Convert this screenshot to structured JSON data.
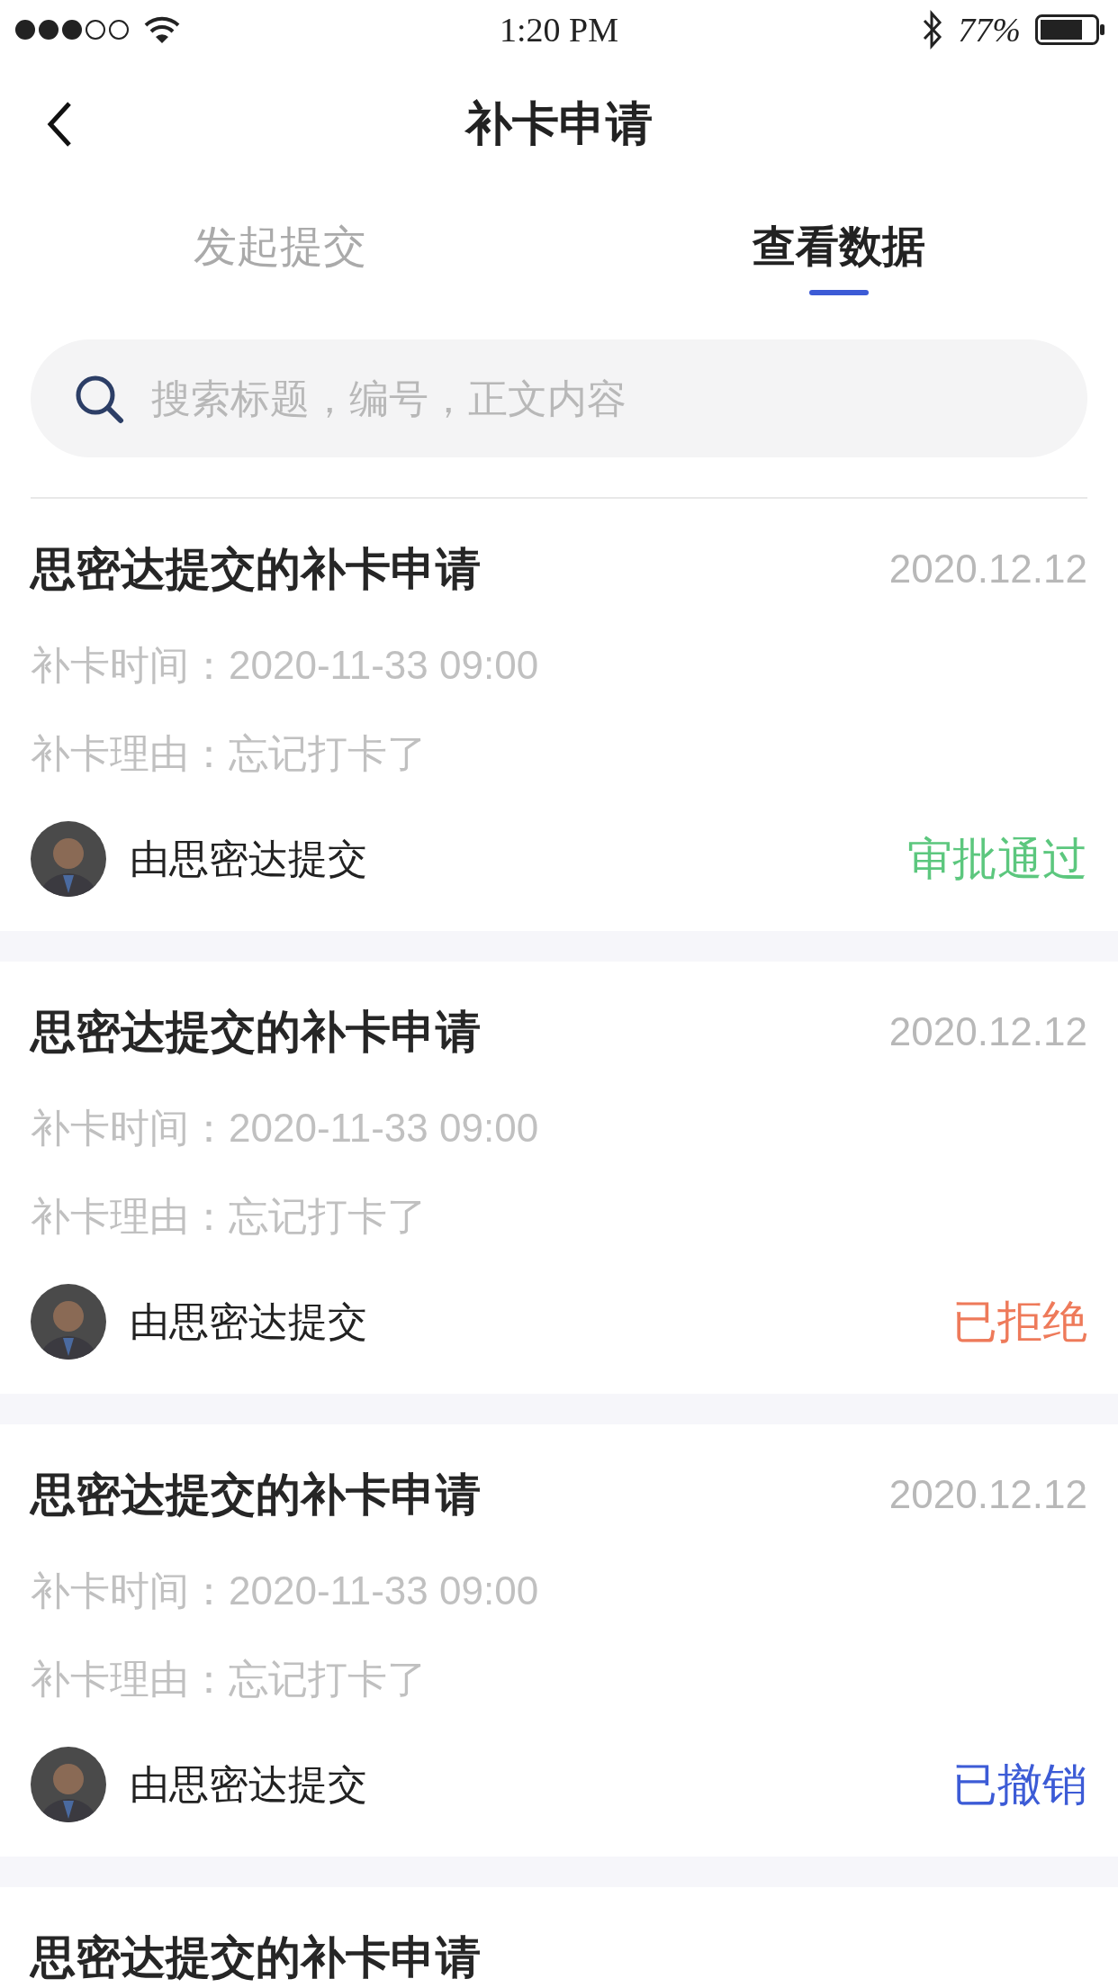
{
  "status_bar": {
    "time": "1:20 PM",
    "battery": "77%"
  },
  "nav": {
    "title": "补卡申请"
  },
  "tabs": [
    {
      "label": "发起提交",
      "selected": false
    },
    {
      "label": "查看数据",
      "selected": true
    }
  ],
  "search": {
    "placeholder": "搜索标题，编号，正文内容"
  },
  "records": [
    {
      "title": "思密达提交的补卡申请",
      "date": "2020.12.12",
      "time": "补卡时间：2020-11-33 09:00",
      "reason": "补卡理由：忘记打卡了",
      "submitter": "由思密达提交",
      "status": "审批通过",
      "kind": "approved"
    },
    {
      "title": "思密达提交的补卡申请",
      "date": "2020.12.12",
      "time": "补卡时间：2020-11-33 09:00",
      "reason": "补卡理由：忘记打卡了",
      "submitter": "由思密达提交",
      "status": "已拒绝",
      "kind": "rejected"
    },
    {
      "title": "思密达提交的补卡申请",
      "date": "2020.12.12",
      "time": "补卡时间：2020-11-33 09:00",
      "reason": "补卡理由：忘记打卡了",
      "submitter": "由思密达提交",
      "status": "已撤销",
      "kind": "revoked"
    },
    {
      "title": "思密达提交的补卡申请"
    }
  ]
}
